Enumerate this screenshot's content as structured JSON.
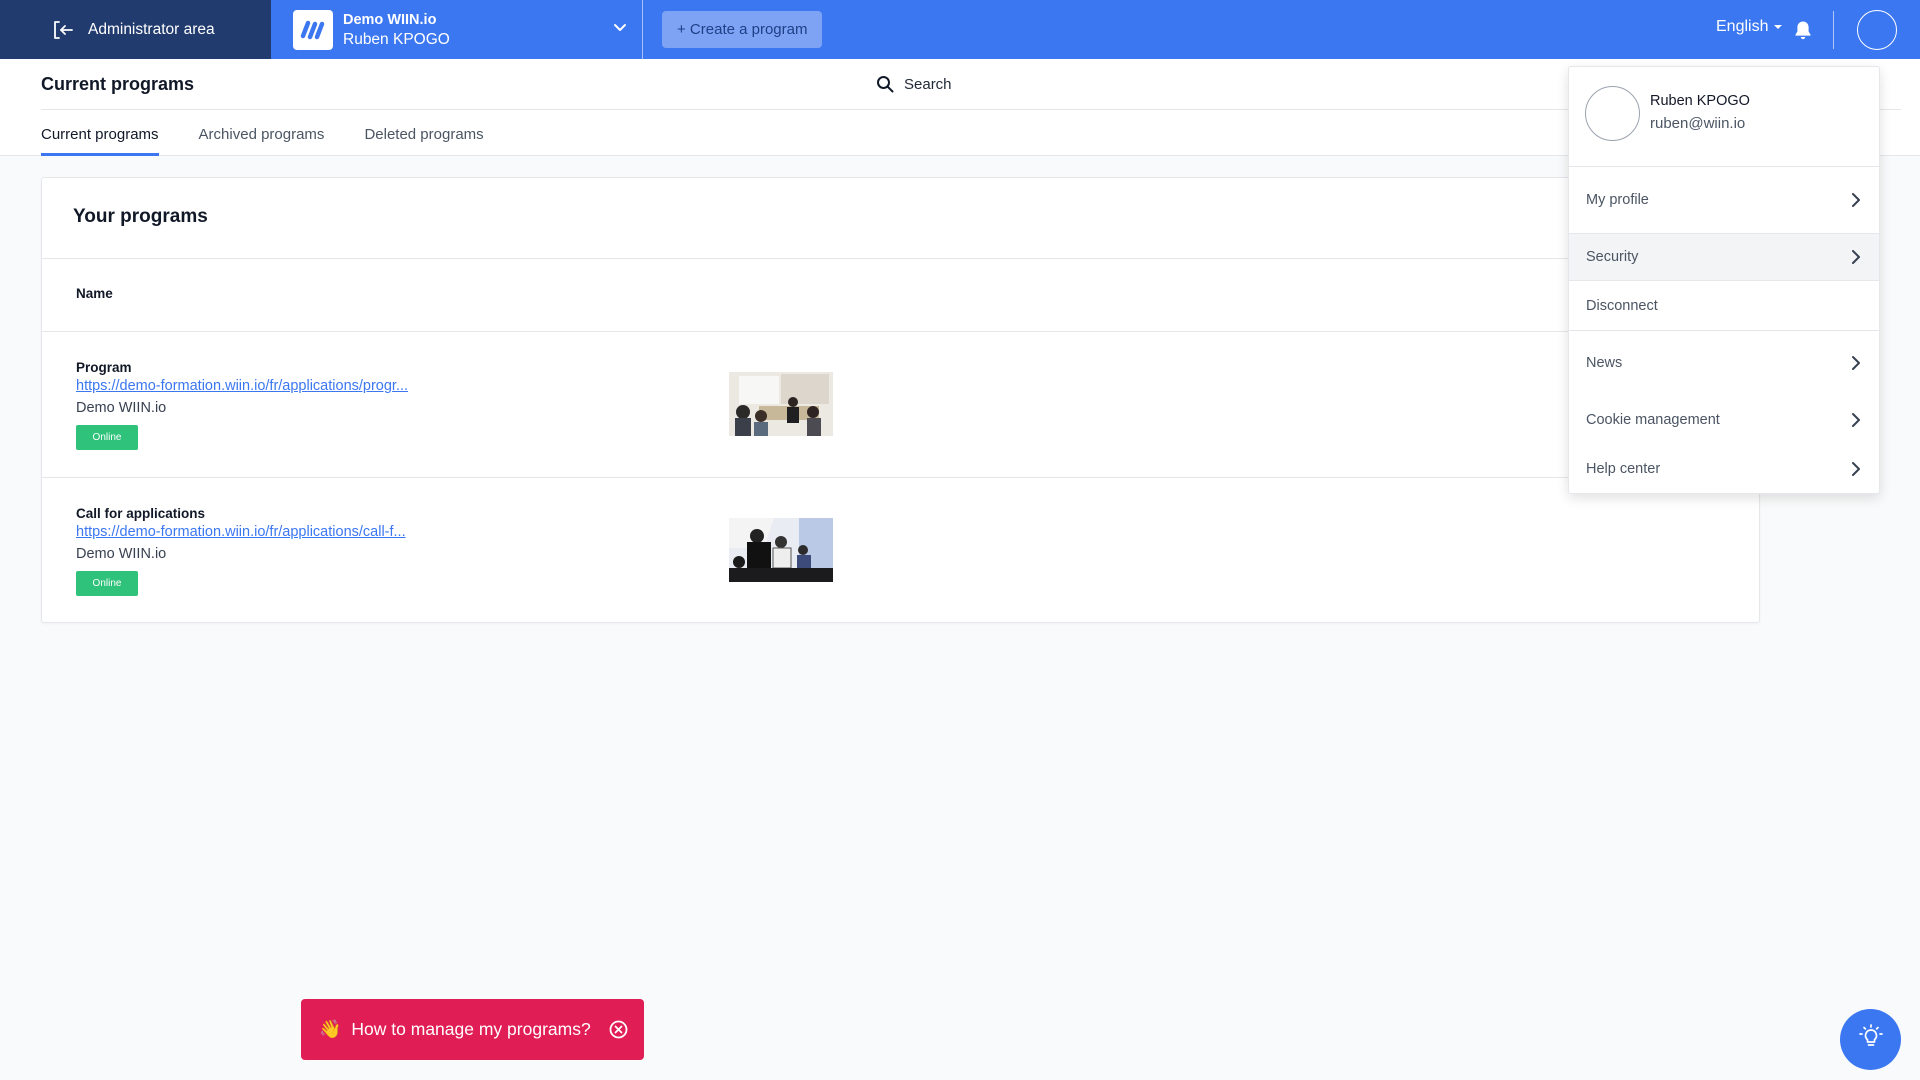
{
  "topbar": {
    "admin_area_label": "Administrator area",
    "org_name": "Demo WIIN.io",
    "org_user": "Ruben KPOGO",
    "create_button_label": "+ Create a program",
    "language": "English",
    "accent_color": "#3b77f0",
    "admin_bg_color": "#213b6e"
  },
  "subheader": {
    "title": "Current programs",
    "search_label": "Search",
    "tabs": [
      {
        "label": "Current programs",
        "active": true
      },
      {
        "label": "Archived programs",
        "active": false
      },
      {
        "label": "Deleted programs",
        "active": false
      }
    ]
  },
  "programs_card": {
    "title": "Your programs",
    "column_name": "Name",
    "rows": [
      {
        "name": "Program",
        "link": "https://demo-formation.wiin.io/fr/applications/progr...",
        "org": "Demo WIIN.io",
        "status": "Online"
      },
      {
        "name": "Call for applications",
        "link": "https://demo-formation.wiin.io/fr/applications/call-f...",
        "org": "Demo WIIN.io",
        "status": "Online"
      }
    ],
    "status_color": "#2fc27a"
  },
  "user_menu": {
    "name": "Ruben KPOGO",
    "email": "ruben@wiin.io",
    "items": [
      {
        "label": "My profile",
        "has_chevron": true
      },
      {
        "label": "Security",
        "has_chevron": true
      },
      {
        "label": "Disconnect",
        "has_chevron": false
      },
      {
        "label": "News",
        "has_chevron": true
      },
      {
        "label": "Cookie management",
        "has_chevron": true
      },
      {
        "label": "Help center",
        "has_chevron": true
      }
    ]
  },
  "help_banner": {
    "label": "How to manage my programs?",
    "color": "#e11d55"
  },
  "icons": [
    "logout-icon",
    "wiin-logo-icon",
    "chevron-down-icon",
    "bell-icon",
    "search-icon",
    "chevron-right-icon",
    "close-circle-icon",
    "lightbulb-icon",
    "wave-hand-icon"
  ]
}
